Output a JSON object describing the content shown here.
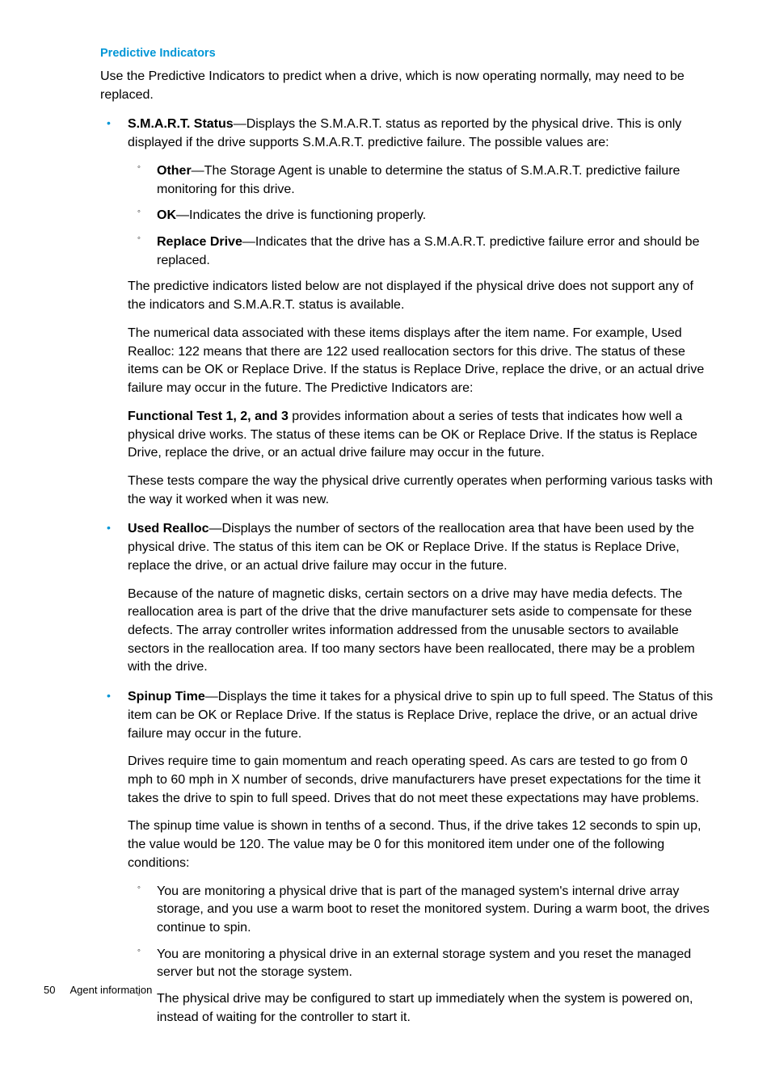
{
  "heading": "Predictive Indicators",
  "intro": "Use the Predictive Indicators to predict when a drive, which is now operating normally, may need to be replaced.",
  "items": [
    {
      "term": "S.M.A.R.T. Status",
      "desc": "—Displays the S.M.A.R.T. status as reported by the physical drive. This is only displayed if the drive supports S.M.A.R.T. predictive failure. The possible values are:",
      "sub": [
        {
          "term": "Other",
          "desc": "—The Storage Agent is unable to determine the status of S.M.A.R.T. predictive failure monitoring for this drive."
        },
        {
          "term": "OK",
          "desc": "—Indicates the drive is functioning properly."
        },
        {
          "term": "Replace Drive",
          "desc": "—Indicates that the drive has a S.M.A.R.T. predictive failure error and should be replaced."
        }
      ],
      "paras": [
        "The predictive indicators listed below are not displayed if the physical drive does not support any of the indicators and S.M.A.R.T. status is available.",
        "The numerical data associated with these items displays after the item name. For example, Used Realloc: 122 means that there are 122 used reallocation sectors for this drive. The status of these items can be OK or Replace Drive. If the status is Replace Drive, replace the drive, or an actual drive failure may occur in the future. The Predictive Indicators are:"
      ],
      "funcTestTerm": "Functional Test 1, 2, and 3",
      "funcTestDesc": " provides information about a series of tests that indicates how well a physical drive works. The status of these items can be OK or Replace Drive. If the status is Replace Drive, replace the drive, or an actual drive failure may occur in the future.",
      "funcTestPara2": "These tests compare the way the physical drive currently operates when performing various tasks with the way it worked when it was new."
    },
    {
      "term": "Used Realloc",
      "desc": "—Displays the number of sectors of the reallocation area that have been used by the physical drive. The status of this item can be OK or Replace Drive. If the status is Replace Drive, replace the drive, or an actual drive failure may occur in the future.",
      "paras": [
        "Because of the nature of magnetic disks, certain sectors on a drive may have media defects. The reallocation area is part of the drive that the drive manufacturer sets aside to compensate for these defects. The array controller writes information addressed from the unusable sectors to available sectors in the reallocation area. If too many sectors have been reallocated, there may be a problem with the drive."
      ]
    },
    {
      "term": "Spinup Time",
      "desc": "—Displays the time it takes for a physical drive to spin up to full speed. The Status of this item can be OK or Replace Drive. If the status is Replace Drive, replace the drive, or an actual drive failure may occur in the future.",
      "paras": [
        "Drives require time to gain momentum and reach operating speed. As cars are tested to go from 0 mph to 60 mph in X number of seconds, drive manufacturers have preset expectations for the time it takes the drive to spin to full speed. Drives that do not meet these expectations may have problems.",
        "The spinup time value is shown in tenths of a second. Thus, if the drive takes 12 seconds to spin up, the value would be 120. The value may be 0 for this monitored item under one of the following conditions:"
      ],
      "sub2": [
        "You are monitoring a physical drive that is part of the managed system's internal drive array storage, and you use a warm boot to reset the monitored system. During a warm boot, the drives continue to spin.",
        "You are monitoring a physical drive in an external storage system and you reset the managed server but not the storage system.",
        "The physical drive may be configured to start up immediately when the system is powered on, instead of waiting for the controller to start it."
      ]
    }
  ],
  "footer": {
    "pageNum": "50",
    "section": "Agent information"
  }
}
